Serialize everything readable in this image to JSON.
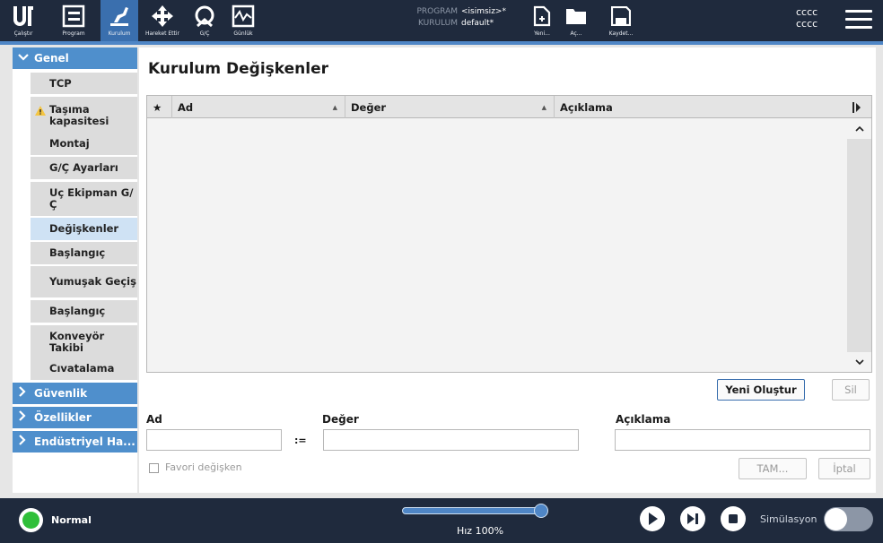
{
  "topbar": {
    "nav": [
      {
        "label": "Çalıştır",
        "icon": "ur-logo-icon"
      },
      {
        "label": "Program",
        "icon": "program-icon"
      },
      {
        "label": "Kurulum",
        "icon": "installation-icon",
        "active": true
      },
      {
        "label": "Hareket Ettir",
        "icon": "move-icon"
      },
      {
        "label": "G/Ç",
        "icon": "io-icon"
      },
      {
        "label": "Günlük",
        "icon": "log-icon"
      }
    ],
    "program_key": "PROGRAM",
    "program_value": "<isimsiz>*",
    "installation_key": "KURULUM",
    "installation_value": "default*",
    "file_actions": [
      {
        "label": "Yeni...",
        "icon": "new-file-icon"
      },
      {
        "label": "Aç...",
        "icon": "open-folder-icon"
      },
      {
        "label": "Kaydet...",
        "icon": "save-icon"
      }
    ],
    "user_line1": "cccc",
    "user_line2": "cccc",
    "menu_icon": "hamburger-menu-icon"
  },
  "sidebar": {
    "sections": [
      {
        "label": "Genel",
        "expanded": true
      },
      {
        "label": "Güvenlik",
        "expanded": false
      },
      {
        "label": "Özellikler",
        "expanded": false
      },
      {
        "label": "Endüstriyel Ha...",
        "expanded": false
      }
    ],
    "items": [
      {
        "label": "TCP"
      },
      {
        "label": "Taşıma kapasitesi",
        "warning": true
      },
      {
        "label": "Montaj"
      },
      {
        "label": "G/Ç Ayarları"
      },
      {
        "label": "Uç Ekipman G/Ç"
      },
      {
        "label": "Değişkenler",
        "selected": true
      },
      {
        "label": "Başlangıç"
      },
      {
        "label": "Yumuşak Geçiş"
      },
      {
        "label": "Başlangıç"
      },
      {
        "label": "Konveyör Takibi"
      },
      {
        "label": "Cıvatalama"
      }
    ]
  },
  "main": {
    "title": "Kurulum Değişkenler",
    "table": {
      "columns": [
        "★",
        "Ad",
        "Değer",
        "Açıklama"
      ],
      "rows": []
    },
    "new_button": "Yeni Oluştur",
    "delete_button": "Sil",
    "form": {
      "name_label": "Ad",
      "assign": ":=",
      "value_label": "Değer",
      "desc_label": "Açıklama",
      "name_value": "",
      "value_value": "",
      "desc_value": "",
      "favorite_label": "Favori değişken",
      "ok_button": "TAM...",
      "cancel_button": "İptal"
    }
  },
  "bottombar": {
    "status": "Normal",
    "status_color": "#2fbf3a",
    "speed_label": "Hız 100%",
    "speed_fraction": 1.0,
    "sim_label": "Simülasyon",
    "sim_on": false
  },
  "colors": {
    "topbar_bg": "#1f2a3d",
    "accent": "#4f86c6",
    "section_header": "#4f8fcc",
    "selected_item": "#cfe2f4"
  }
}
